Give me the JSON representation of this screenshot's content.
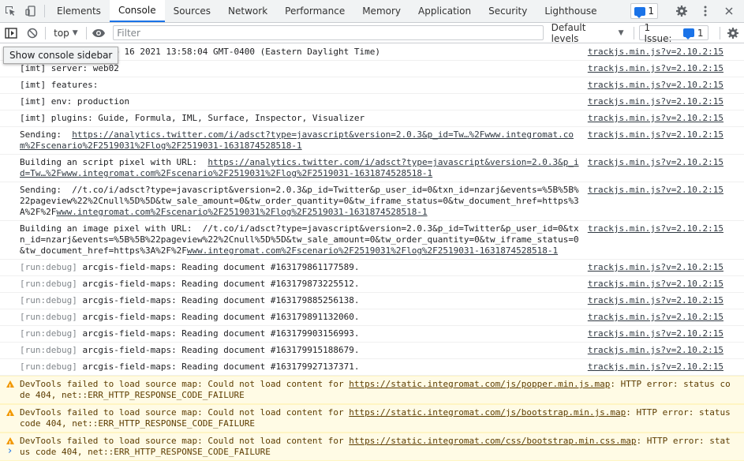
{
  "tabs": [
    {
      "label": "Elements"
    },
    {
      "label": "Console"
    },
    {
      "label": "Sources"
    },
    {
      "label": "Network"
    },
    {
      "label": "Performance"
    },
    {
      "label": "Memory"
    },
    {
      "label": "Application"
    },
    {
      "label": "Security"
    },
    {
      "label": "Lighthouse"
    }
  ],
  "active_tab": "Console",
  "messages_badge": "1",
  "toolbar": {
    "context": "top",
    "filter_placeholder": "Filter",
    "levels": "Default levels",
    "issues_label": "1 Issue:",
    "issues_count": "1"
  },
  "tooltip": "Show console sidebar",
  "logs": [
    {
      "text": "[imt] date: Thu Sep 16 2021 13:58:04 GMT-0400 (Eastern Daylight Time)",
      "source": "trackjs.min.js?v=2.10.2:15"
    },
    {
      "text": "[imt] server: web02",
      "source": "trackjs.min.js?v=2.10.2:15"
    },
    {
      "text": "[imt] features:",
      "source": "trackjs.min.js?v=2.10.2:15"
    },
    {
      "text": "[imt] env: production",
      "source": "trackjs.min.js?v=2.10.2:15"
    },
    {
      "text": "[imt] plugins: Guide, Formula, IML, Surface, Inspector, Visualizer",
      "source": "trackjs.min.js?v=2.10.2:15"
    },
    {
      "prefix": "Sending:  ",
      "link": "https://analytics.twitter.com/i/adsct?type=javascript&version=2.0.3&p_id=Tw…%2Fwww.integromat.com%2Fscenario%2F2519031%2Flog%2F2519031-1631874528518-1",
      "source": "trackjs.min.js?v=2.10.2:15"
    },
    {
      "prefix": "Building an script pixel with URL:  ",
      "link": "https://analytics.twitter.com/i/adsct?type=javascript&version=2.0.3&p_id=Tw…%2Fwww.integromat.com%2Fscenario%2F2519031%2Flog%2F2519031-1631874528518-1",
      "source": "trackjs.min.js?v=2.10.2:15"
    },
    {
      "prefix": "Sending:  //t.co/i/adsct?type=javascript&version=2.0.3&p_id=Twitter&p_user_id=0&txn_id=nzarj&events=%5B%5B%22pageview%22%2Cnull%5D%5D&tw_sale_amount=0&tw_order_quantity=0&tw_iframe_status=0&tw_document_href=https%3A%2F%2F",
      "link": "www.integromat.com%2Fscenario%2F2519031%2Flog%2F2519031-1631874528518-1",
      "source": "trackjs.min.js?v=2.10.2:15"
    },
    {
      "prefix": "Building an image pixel with URL:  //t.co/i/adsct?type=javascript&version=2.0.3&p_id=Twitter&p_user_id=0&txn_id=nzarj&events=%5B%5B%22pageview%22%2Cnull%5D%5D&tw_sale_amount=0&tw_order_quantity=0&tw_iframe_status=0&tw_document_href=https%3A%2F%2F",
      "link": "www.integromat.com%2Fscenario%2F2519031%2Flog%2F2519031-1631874528518-1",
      "source": "trackjs.min.js?v=2.10.2:15"
    },
    {
      "tag": "[run:debug]",
      "text": " arcgis-field-maps: Reading document #163179861177589.",
      "source": "trackjs.min.js?v=2.10.2:15"
    },
    {
      "tag": "[run:debug]",
      "text": " arcgis-field-maps: Reading document #163179873225512.",
      "source": "trackjs.min.js?v=2.10.2:15"
    },
    {
      "tag": "[run:debug]",
      "text": " arcgis-field-maps: Reading document #163179885256138.",
      "source": "trackjs.min.js?v=2.10.2:15"
    },
    {
      "tag": "[run:debug]",
      "text": " arcgis-field-maps: Reading document #163179891132060.",
      "source": "trackjs.min.js?v=2.10.2:15"
    },
    {
      "tag": "[run:debug]",
      "text": " arcgis-field-maps: Reading document #163179903156993.",
      "source": "trackjs.min.js?v=2.10.2:15"
    },
    {
      "tag": "[run:debug]",
      "text": " arcgis-field-maps: Reading document #163179915188679.",
      "source": "trackjs.min.js?v=2.10.2:15"
    },
    {
      "tag": "[run:debug]",
      "text": " arcgis-field-maps: Reading document #163179927137371.",
      "source": "trackjs.min.js?v=2.10.2:15"
    }
  ],
  "warnings": [
    {
      "prefix": "DevTools failed to load source map: Could not load content for ",
      "link": "https://static.integromat.com/js/popper.min.js.map",
      "suffix": ": HTTP error: status code 404, net::ERR_HTTP_RESPONSE_CODE_FAILURE"
    },
    {
      "prefix": "DevTools failed to load source map: Could not load content for ",
      "link": "https://static.integromat.com/js/bootstrap.min.js.map",
      "suffix": ": HTTP error: status code 404, net::ERR_HTTP_RESPONSE_CODE_FAILURE"
    },
    {
      "prefix": "DevTools failed to load source map: Could not load content for ",
      "link": "https://static.integromat.com/css/bootstrap.min.css.map",
      "suffix": ": HTTP error: status code 404, net::ERR_HTTP_RESPONSE_CODE_FAILURE"
    }
  ],
  "prompt_symbol": "›",
  "colors": {
    "accent": "#1a73e8",
    "warning": "#f29900",
    "warning_bg": "#fffbe5"
  }
}
